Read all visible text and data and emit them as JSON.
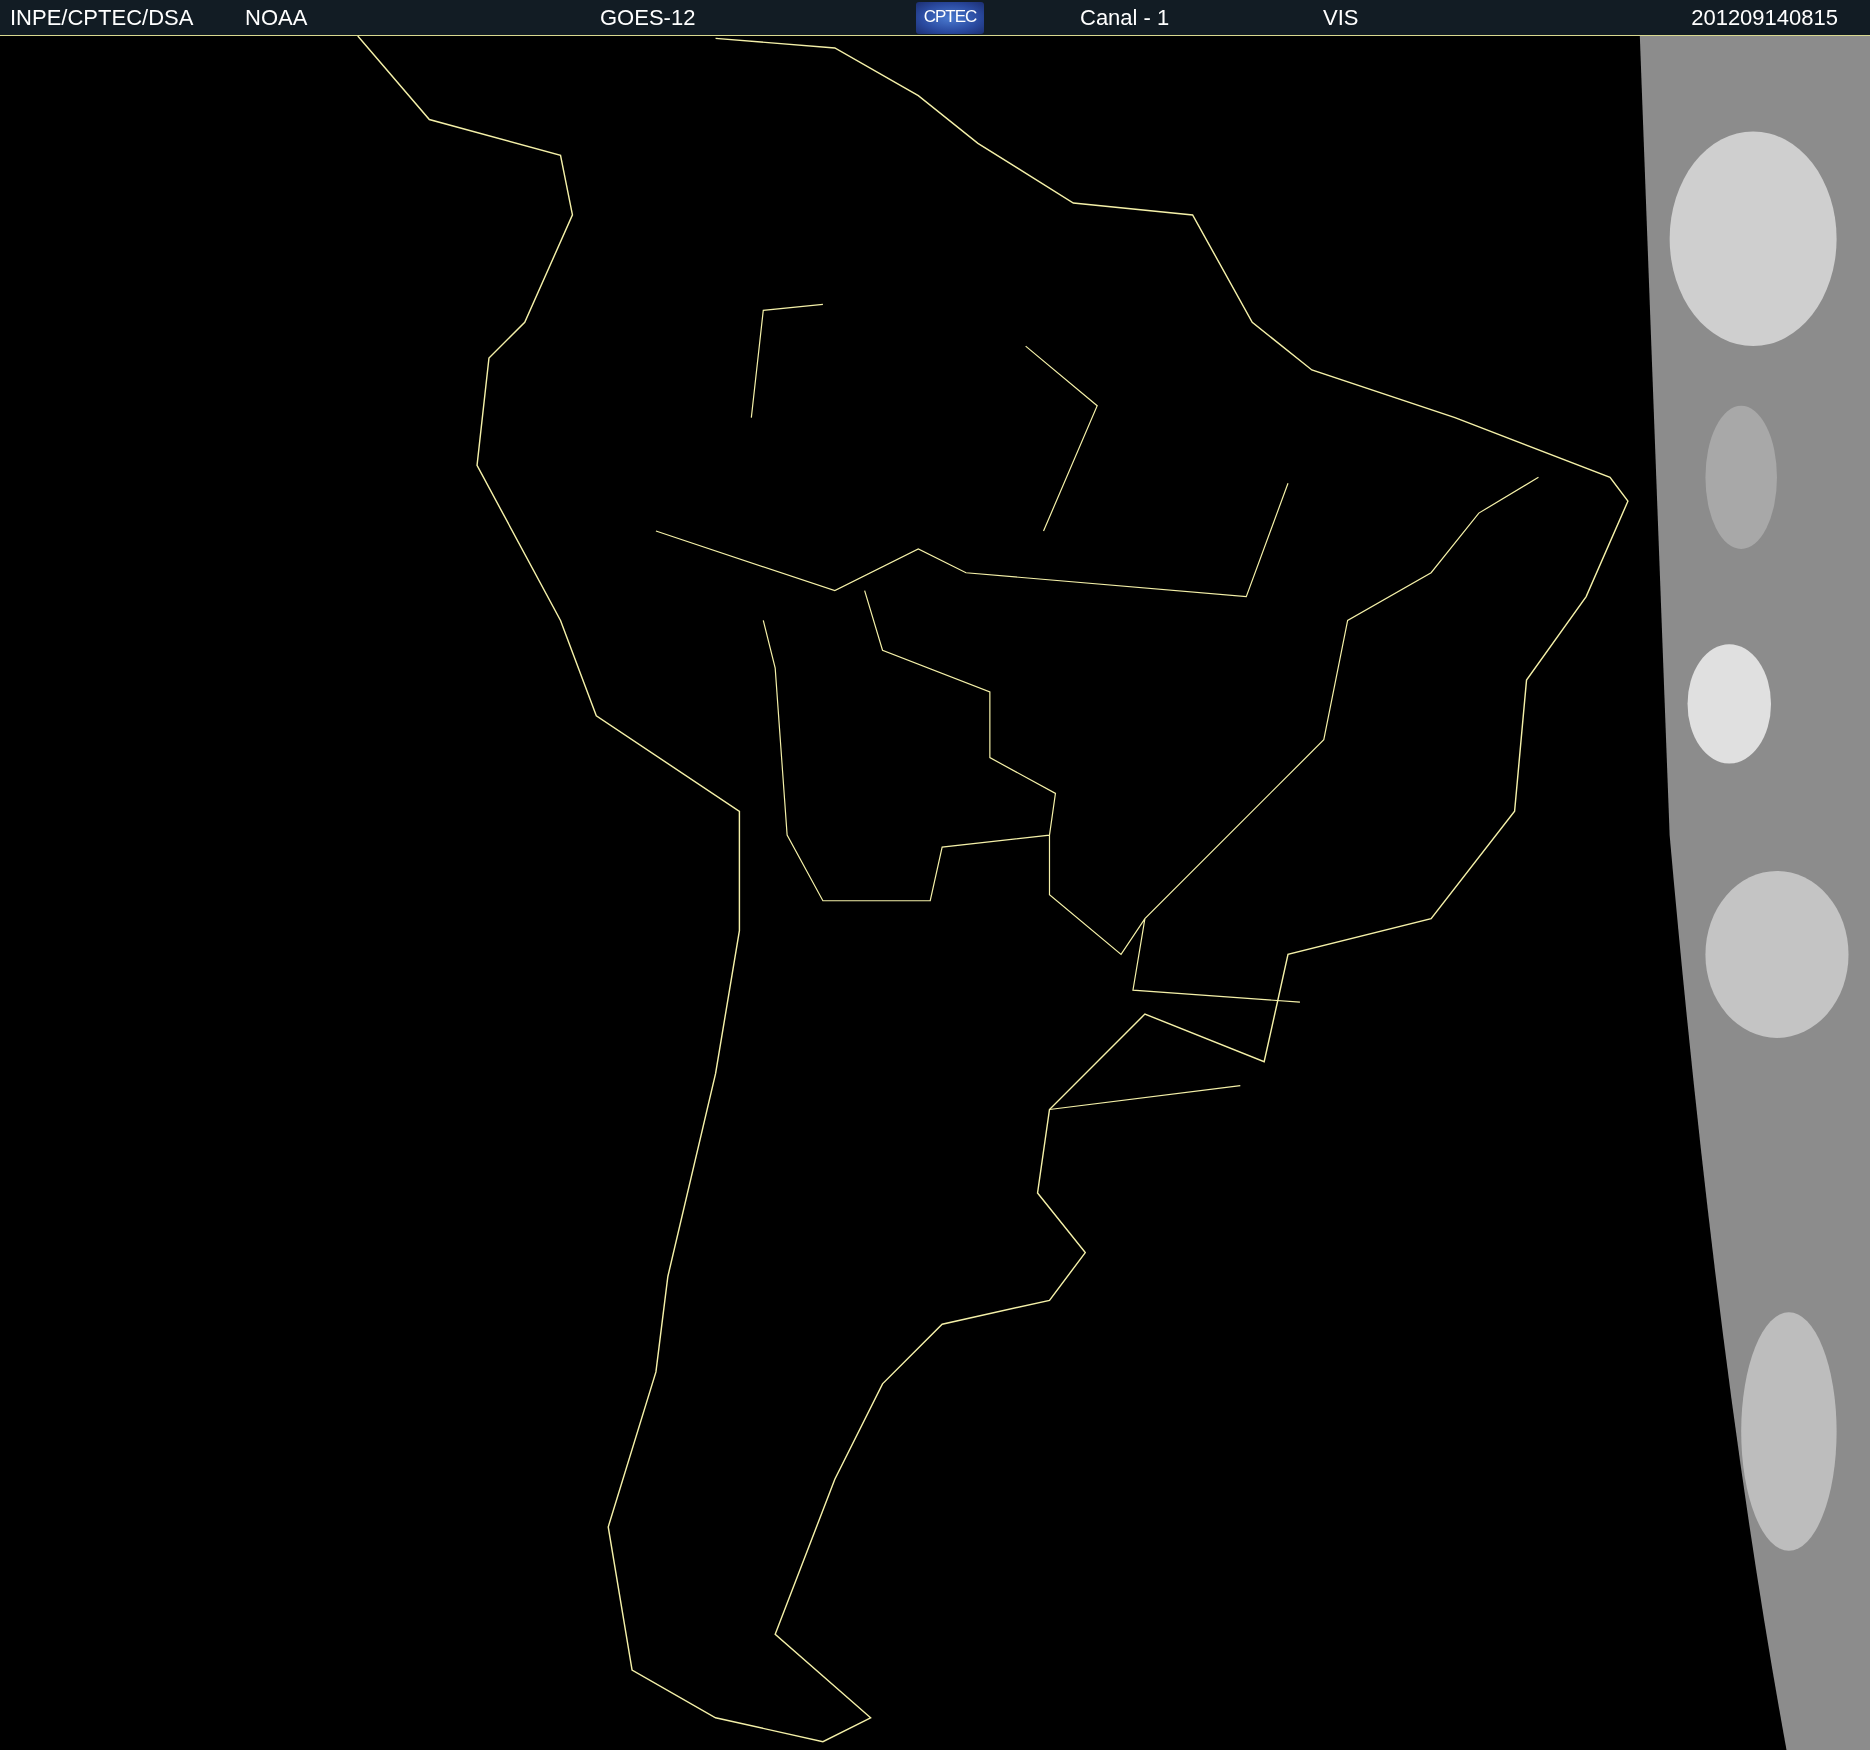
{
  "header": {
    "items": [
      {
        "kind": "text",
        "text": "INPE/CPTEC/DSA"
      },
      {
        "kind": "text",
        "text": "NOAA"
      },
      {
        "kind": "text",
        "text": "GOES-12"
      },
      {
        "kind": "logo",
        "text": "CPTEC"
      },
      {
        "kind": "text",
        "text": "Canal - 1"
      },
      {
        "kind": "text",
        "text": "VIS"
      },
      {
        "kind": "text",
        "text": "201209140815"
      }
    ]
  }
}
